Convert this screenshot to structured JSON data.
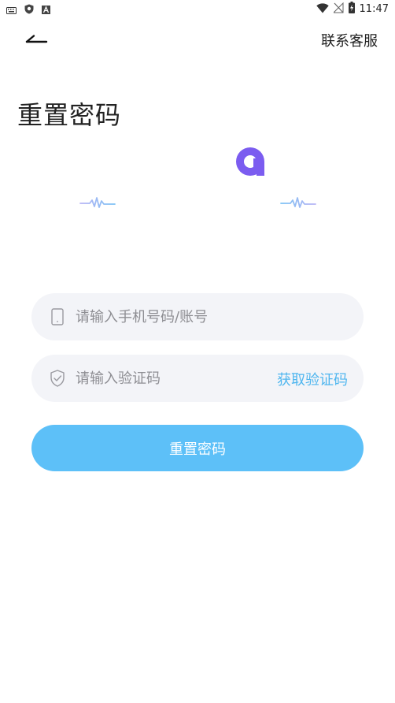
{
  "status_bar": {
    "time": "11:47",
    "icons": [
      "keyboard-icon",
      "shield-icon",
      "a-badge-icon",
      "wifi-icon",
      "no-signal-icon",
      "battery-charging-icon"
    ]
  },
  "header": {
    "back_icon": "arrow-left-icon",
    "contact_label": "联系客服"
  },
  "page": {
    "title": "重置密码"
  },
  "form": {
    "phone": {
      "placeholder": "请输入手机号码/账号",
      "value": "",
      "icon": "phone-icon"
    },
    "code": {
      "placeholder": "请输入验证码",
      "value": "",
      "icon": "shield-check-icon"
    },
    "get_code_label": "获取验证码",
    "submit_label": "重置密码"
  },
  "colors": {
    "accent": "#5dc0f8",
    "link": "#4fb6ef",
    "field_bg": "#f3f4f8",
    "logo": "#7b5cf0"
  }
}
